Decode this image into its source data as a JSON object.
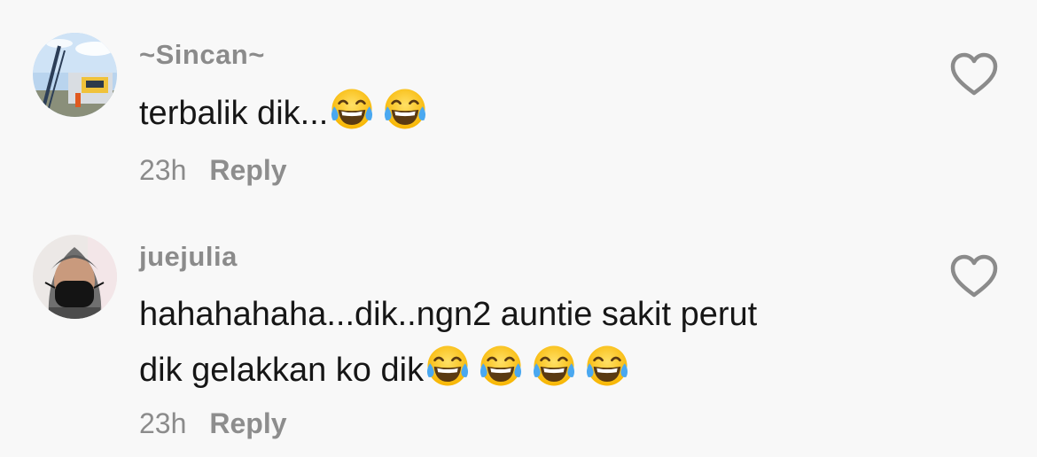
{
  "comments": [
    {
      "username": "~Sincan~",
      "text": "terbalik dik...",
      "emojis": [
        "face-with-tears-of-joy",
        "face-with-tears-of-joy"
      ],
      "time": "23h",
      "reply_label": "Reply"
    },
    {
      "username": "juejulia",
      "text_line1": "hahahahaha...dik..ngn2 auntie sakit perut",
      "text_line2": "dik gelakkan ko dik",
      "emojis": [
        "face-with-tears-of-joy",
        "face-with-tears-of-joy",
        "face-with-tears-of-joy",
        "face-with-tears-of-joy"
      ],
      "time": "23h",
      "reply_label": "Reply"
    }
  ],
  "colors": {
    "background": "#f8f8f8",
    "username": "#8b8b8b",
    "text": "#161616",
    "meta": "#8b8b8b",
    "heart_outline": "#8b8b8b"
  },
  "icons": {
    "like": "heart-outline-icon",
    "emoji": "face-with-tears-of-joy"
  }
}
